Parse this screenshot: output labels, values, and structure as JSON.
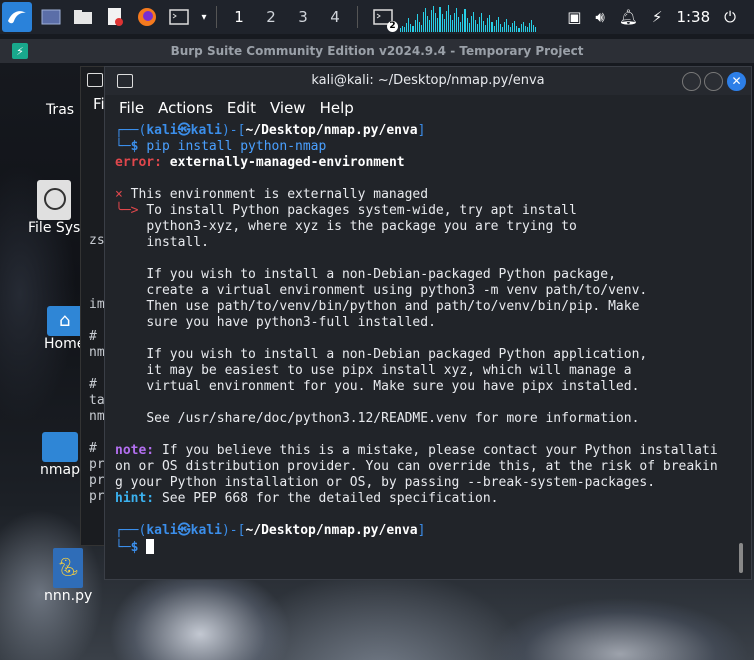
{
  "panel": {
    "workspaces": [
      "1",
      "2",
      "3",
      "4"
    ],
    "active_workspace": "1",
    "terminal_badge": "2",
    "clock": "1:38",
    "accent": "#27d0e8"
  },
  "burp": {
    "title": "Burp Suite Community Edition v2024.9.4 - Temporary Project"
  },
  "desktop": {
    "icons": [
      "Trash",
      "File System",
      "Home",
      "nmap",
      "nnn.py"
    ],
    "icon_labels_visible": [
      "Tras",
      "File Sys",
      "Home",
      "nmap",
      "nnn.py"
    ]
  },
  "background_window": {
    "menu_fragment": "Fi",
    "lines": [
      "zs  s",
      "im",
      "#",
      "nm",
      "#",
      "ta",
      "nm",
      "#",
      "pr",
      "pr",
      "pr"
    ]
  },
  "terminal": {
    "title": "kali@kali: ~/Desktop/nmap.py/enva",
    "menu": [
      "File",
      "Actions",
      "Edit",
      "View",
      "Help"
    ],
    "prompt_user": "kali",
    "prompt_host": "kali",
    "prompt_path": "~/Desktop/nmap.py/enva",
    "command": "pip install python-nmap",
    "error_label": "error:",
    "error_text": " externally-managed-environment",
    "managed_line": " This environment is externally managed",
    "body_lines": [
      "To install Python packages system-wide, try apt install",
      "python3-xyz, where xyz is the package you are trying to",
      "install.",
      "",
      "If you wish to install a non-Debian-packaged Python package,",
      "create a virtual environment using python3 -m venv path/to/venv.",
      "Then use path/to/venv/bin/python and path/to/venv/bin/pip. Make",
      "sure you have python3-full installed.",
      "",
      "If you wish to install a non-Debian packaged Python application,",
      "it may be easiest to use pipx install xyz, which will manage a",
      "virtual environment for you. Make sure you have pipx installed.",
      "",
      "See /usr/share/doc/python3.12/README.venv for more information."
    ],
    "note_label": "note:",
    "note_lines": [
      " If you believe this is a mistake, please contact your Python installati",
      "on or OS distribution provider. You can override this, at the risk of breakin",
      "g your Python installation or OS, by passing --break-system-packages."
    ],
    "hint_label": "hint:",
    "hint_text": " See PEP 668 for the detailed specification."
  }
}
